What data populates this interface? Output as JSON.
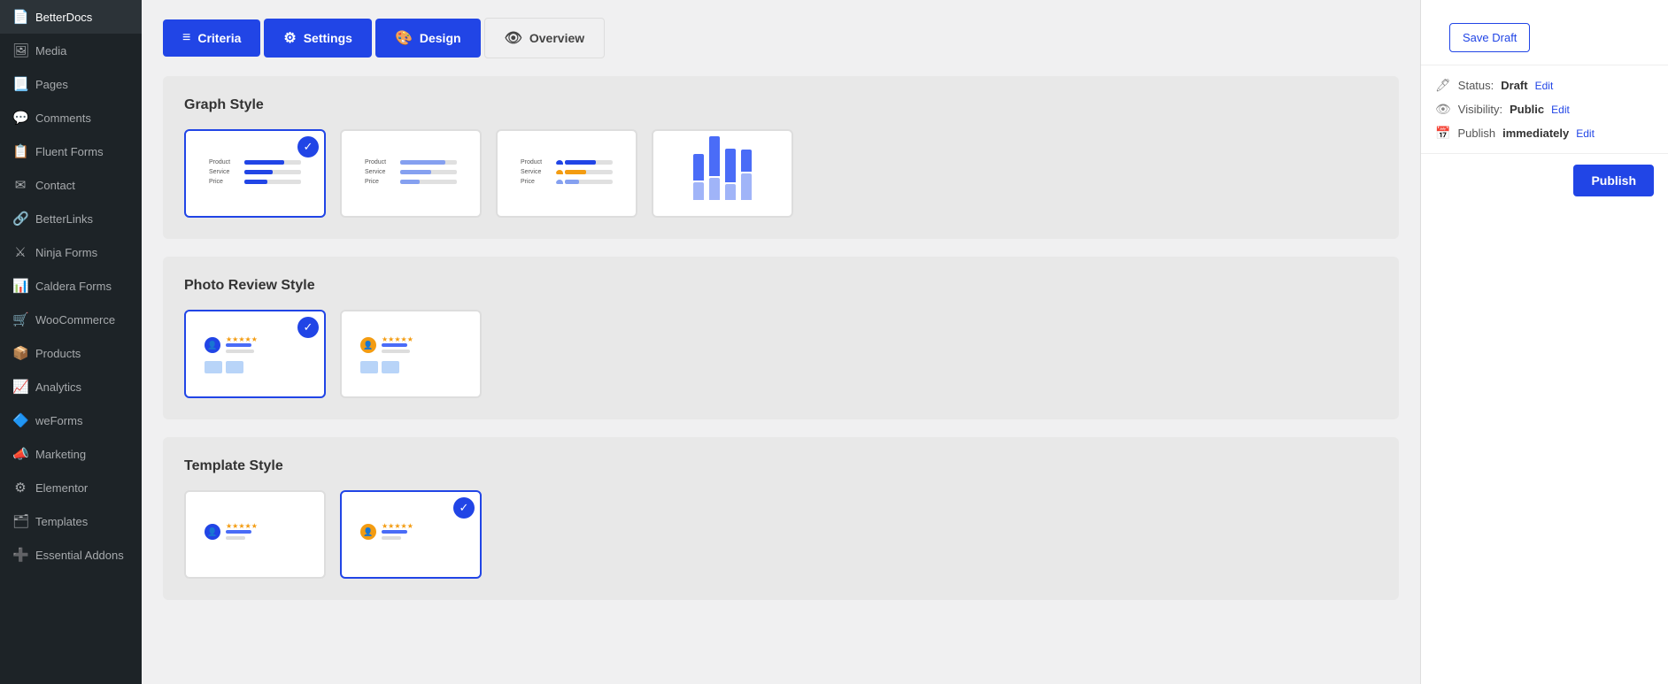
{
  "sidebar": {
    "items": [
      {
        "id": "betterdocs",
        "label": "BetterDocs",
        "icon": "📄"
      },
      {
        "id": "media",
        "label": "Media",
        "icon": "🖼"
      },
      {
        "id": "pages",
        "label": "Pages",
        "icon": "📃"
      },
      {
        "id": "comments",
        "label": "Comments",
        "icon": "💬"
      },
      {
        "id": "fluent-forms",
        "label": "Fluent Forms",
        "icon": "📋"
      },
      {
        "id": "contact",
        "label": "Contact",
        "icon": "✉"
      },
      {
        "id": "betterlinks",
        "label": "BetterLinks",
        "icon": "🔗"
      },
      {
        "id": "ninja-forms",
        "label": "Ninja Forms",
        "icon": "⚔"
      },
      {
        "id": "caldera-forms",
        "label": "Caldera Forms",
        "icon": "📊"
      },
      {
        "id": "woocommerce",
        "label": "WooCommerce",
        "icon": "🛒"
      },
      {
        "id": "products",
        "label": "Products",
        "icon": "📦"
      },
      {
        "id": "analytics",
        "label": "Analytics",
        "icon": "📈"
      },
      {
        "id": "weforms",
        "label": "weForms",
        "icon": "🔷"
      },
      {
        "id": "marketing",
        "label": "Marketing",
        "icon": "📣"
      },
      {
        "id": "elementor",
        "label": "Elementor",
        "icon": "⚙"
      },
      {
        "id": "templates",
        "label": "Templates",
        "icon": "🗂"
      },
      {
        "id": "essential-addons",
        "label": "Essential Addons",
        "icon": "➕"
      }
    ]
  },
  "tabs": [
    {
      "id": "criteria",
      "label": "Criteria",
      "icon": "≡",
      "active": true,
      "style": "blue"
    },
    {
      "id": "settings",
      "label": "Settings",
      "icon": "⚙",
      "active": true,
      "style": "blue"
    },
    {
      "id": "design",
      "label": "Design",
      "icon": "🎨",
      "active": true,
      "style": "blue"
    },
    {
      "id": "overview",
      "label": "Overview",
      "icon": "👁",
      "active": false,
      "style": "inactive"
    }
  ],
  "sections": {
    "graph_style": {
      "title": "Graph Style",
      "options": [
        {
          "id": "table-1",
          "selected": true
        },
        {
          "id": "table-2",
          "selected": false
        },
        {
          "id": "table-3",
          "selected": false
        },
        {
          "id": "bar-chart",
          "selected": false
        }
      ]
    },
    "photo_review": {
      "title": "Photo Review Style",
      "options": [
        {
          "id": "photo-1",
          "selected": true
        },
        {
          "id": "photo-2",
          "selected": false
        }
      ]
    },
    "template_style": {
      "title": "Template Style",
      "options": [
        {
          "id": "template-1",
          "selected": false
        },
        {
          "id": "template-2",
          "selected": true
        }
      ]
    }
  },
  "panel": {
    "save_draft_label": "Save Draft",
    "status_label": "Status:",
    "status_value": "Draft",
    "status_edit": "Edit",
    "visibility_label": "Visibility:",
    "visibility_value": "Public",
    "visibility_edit": "Edit",
    "publish_label_text": "Publish",
    "publish_timing": "immediately",
    "publish_timing_edit": "Edit",
    "publish_btn_label": "Publish"
  }
}
